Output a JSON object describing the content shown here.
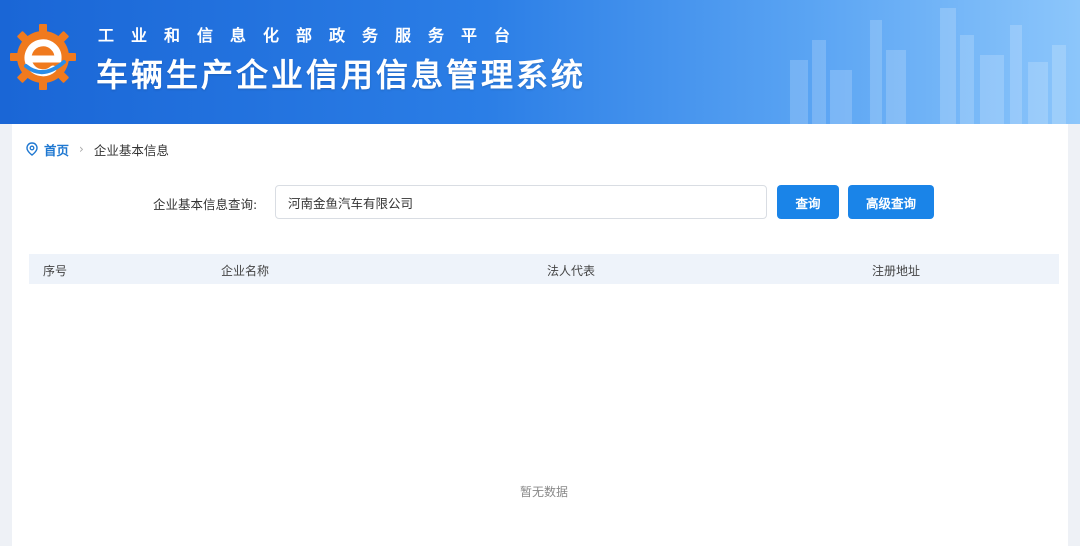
{
  "header": {
    "platform_name": "工业和信息化部政务服务平台",
    "system_title": "车辆生产企业信用信息管理系统"
  },
  "breadcrumb": {
    "home": "首页",
    "current": "企业基本信息"
  },
  "search": {
    "label": "企业基本信息查询:",
    "value": "河南金鱼汽车有限公司",
    "query_button": "查询",
    "advanced_button": "高级查询"
  },
  "table": {
    "columns": [
      "序号",
      "企业名称",
      "法人代表",
      "注册地址"
    ],
    "rows": [],
    "empty_text": "暂无数据"
  },
  "colors": {
    "header_blue": "#1a66d6",
    "accent": "#1a84e8",
    "logo_orange": "#f07a1e",
    "header_row": "#eef3fa"
  }
}
